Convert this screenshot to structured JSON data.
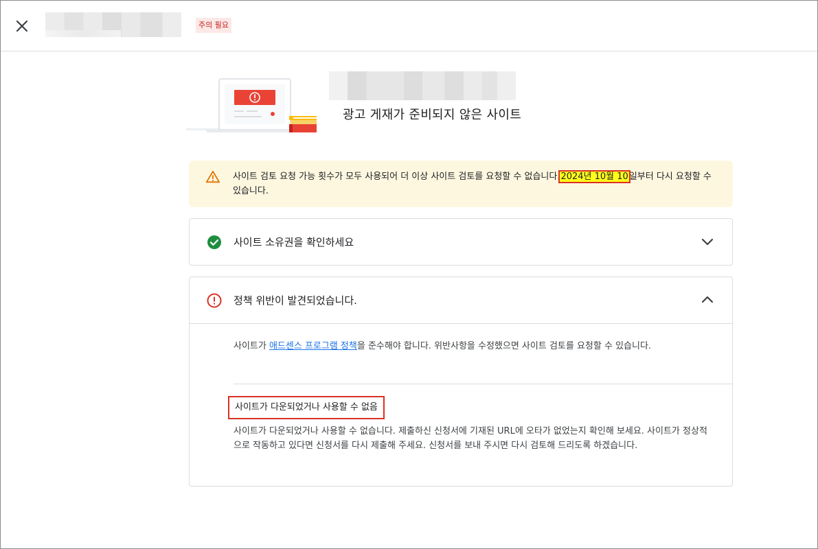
{
  "header": {
    "badge_label": "주의 필요"
  },
  "hero": {
    "status": "광고 게재가 준비되지 않은 사이트"
  },
  "warning": {
    "text_before": "사이트 검토 요청 가능 횟수가 모두 사용되어 더 이상 사이트 검토를 요청할 수 없습니다.",
    "date": "2024년 10월 10",
    "text_after": "일부터 다시 요청할 수 있습니다."
  },
  "ownership_card": {
    "title": "사이트 소유권을 확인하세요",
    "expanded": false
  },
  "policy_card": {
    "title": "정책 위반이 발견되었습니다.",
    "expanded": true,
    "desc_before": "사이트가 ",
    "desc_link": "애드센스 프로그램 정책",
    "desc_after": "을 준수해야 합니다. 위반사항을 수정했으면 사이트 검토를 요청할 수 있습니다.",
    "issue_title": "사이트가 다운되었거나 사용할 수 없음",
    "issue_body": "사이트가 다운되었거나 사용할 수 없습니다. 제출하신 신청서에 기재된 URL에 오타가 없었는지 확인해 보세요. 사이트가 정상적으로 작동하고 있다면 신청서를 다시 제출해 주세요. 신청서를 보내 주시면 다시 검토해 드리도록 하겠습니다."
  },
  "colors": {
    "warning_bg": "#fef7e0",
    "warning_icon": "#e37400",
    "success": "#1e8e3e",
    "error": "#d93025",
    "link": "#1a73e8",
    "badge_bg": "#fce8e6",
    "badge_text": "#c5221f"
  },
  "icons": {
    "close": "close-icon",
    "warning": "warning-triangle-icon",
    "ownership": "check-circle-icon",
    "policy": "error-circle-icon",
    "collapsed": "chevron-down-icon",
    "expanded": "chevron-up-icon"
  }
}
